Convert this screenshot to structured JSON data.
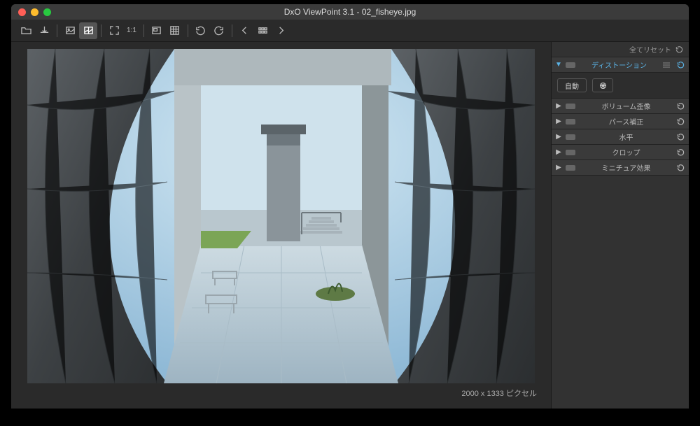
{
  "window": {
    "title": "DxO ViewPoint 3.1 - 02_fisheye.jpg"
  },
  "toolbar": {
    "oneToOne": "1:1"
  },
  "canvas": {
    "dimensions": "2000 x 1333 ピクセル"
  },
  "sidebar": {
    "reset_all_label": "全てリセット",
    "panels": [
      {
        "label": "ディストーション",
        "expanded": true
      },
      {
        "label": "ボリューム歪像",
        "expanded": false
      },
      {
        "label": "パース補正",
        "expanded": false
      },
      {
        "label": "水平",
        "expanded": false
      },
      {
        "label": "クロップ",
        "expanded": false
      },
      {
        "label": "ミニチュア効果",
        "expanded": false
      }
    ],
    "distortion": {
      "auto_label": "自動"
    }
  }
}
